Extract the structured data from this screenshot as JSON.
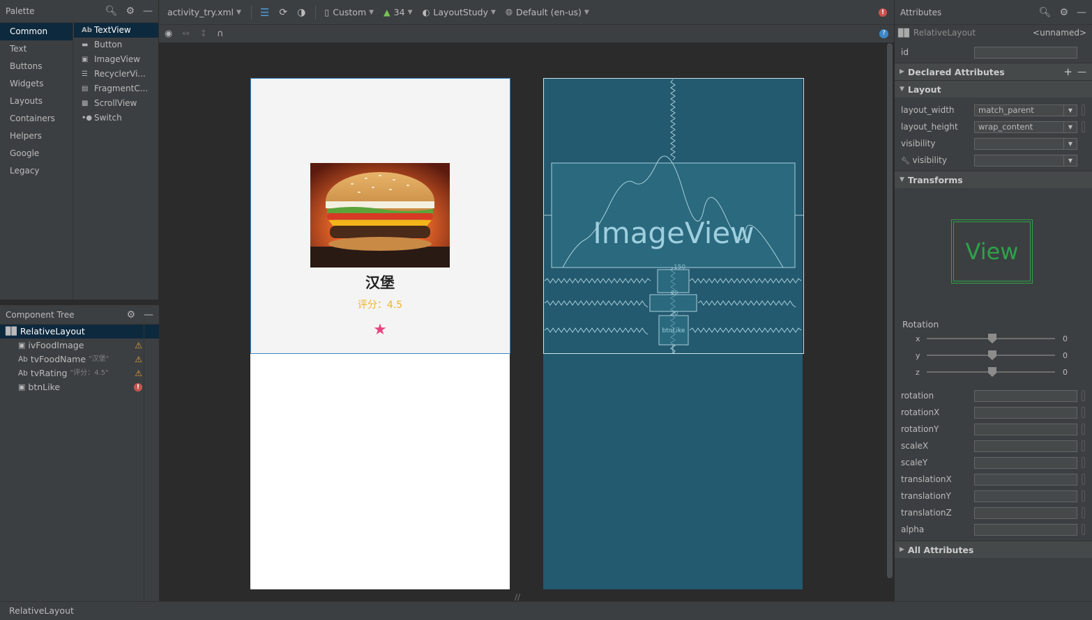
{
  "palette": {
    "title": "Palette",
    "categories": [
      "Common",
      "Text",
      "Buttons",
      "Widgets",
      "Layouts",
      "Containers",
      "Helpers",
      "Google",
      "Legacy"
    ],
    "items": [
      {
        "icon": "Ab",
        "label": "TextView"
      },
      {
        "icon": "btn",
        "label": "Button"
      },
      {
        "icon": "img",
        "label": "ImageView"
      },
      {
        "icon": "list",
        "label": "RecyclerVi..."
      },
      {
        "icon": "frag",
        "label": "FragmentC..."
      },
      {
        "icon": "scroll",
        "label": "ScrollView"
      },
      {
        "icon": "switch",
        "label": "Switch"
      }
    ]
  },
  "component_tree": {
    "title": "Component Tree",
    "root": "RelativeLayout",
    "children": [
      {
        "icon": "img",
        "name": "ivFoodImage",
        "hint": "",
        "status": "warning"
      },
      {
        "icon": "Ab",
        "name": "tvFoodName",
        "hint": "\"汉堡\"",
        "status": "warning"
      },
      {
        "icon": "Ab",
        "name": "tvRating",
        "hint": "\"评分：4.5\"",
        "status": "warning"
      },
      {
        "icon": "img",
        "name": "btnLike",
        "hint": "",
        "status": "error"
      }
    ]
  },
  "toolbar": {
    "file": "activity_try.xml",
    "device": "Custom",
    "api": "34",
    "theme": "LayoutStudy",
    "locale": "Default (en-us)"
  },
  "design": {
    "food_name": "汉堡",
    "rating": "评分：4.5",
    "like_icon": "star-icon",
    "colors": {
      "rating": "#f0b429",
      "like": "#e8437e",
      "blueprint": "#235a6f"
    }
  },
  "blueprint": {
    "imageview_label": "ImageView",
    "button_label": "btnLike",
    "margin_label": "150",
    "small_labels": [
      "20",
      "20"
    ]
  },
  "attributes": {
    "title": "Attributes",
    "component": "RelativeLayout",
    "component_id": "<unnamed>",
    "id_label": "id",
    "sections": {
      "declared": "Declared Attributes",
      "layout": "Layout",
      "transforms": "Transforms",
      "all": "All Attributes"
    },
    "layout_rows": [
      {
        "label": "layout_width",
        "value": "match_parent"
      },
      {
        "label": "layout_height",
        "value": "wrap_content"
      },
      {
        "label": "visibility",
        "value": ""
      },
      {
        "label": "visibility",
        "value": ""
      }
    ],
    "view_preview": "View",
    "rotation_title": "Rotation",
    "rotation_axes": [
      {
        "axis": "x",
        "value": "0"
      },
      {
        "axis": "y",
        "value": "0"
      },
      {
        "axis": "z",
        "value": "0"
      }
    ],
    "transform_rows": [
      "rotation",
      "rotationX",
      "rotationY",
      "scaleX",
      "scaleY",
      "translationX",
      "translationY",
      "translationZ",
      "alpha"
    ]
  },
  "status_bar": "RelativeLayout"
}
